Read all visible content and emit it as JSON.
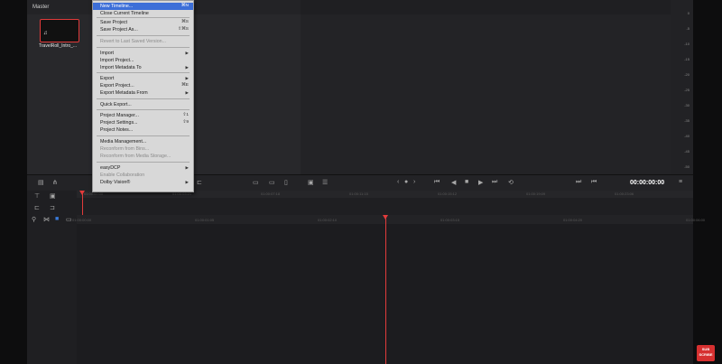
{
  "media_pool": {
    "header": "Master",
    "clip_name": "TravelRoll_Intro_...",
    "clip_glyph": "♫"
  },
  "file_menu": {
    "items": [
      {
        "label": "New Timeline...",
        "shortcut": "⌘N",
        "highlighted": true
      },
      {
        "label": "Close Current Timeline",
        "shortcut": ""
      },
      {
        "label": "Save Project",
        "shortcut": "⌘S"
      },
      {
        "label": "Save Project As...",
        "shortcut": "⇧⌘S"
      },
      {
        "label": "Revert to Last Saved Version...",
        "shortcut": "",
        "disabled": true
      },
      {
        "label": "Import",
        "arrow": "▶"
      },
      {
        "label": "Import Project...",
        "shortcut": ""
      },
      {
        "label": "Import Metadata To",
        "arrow": "▶"
      },
      {
        "label": "Export",
        "arrow": "▶"
      },
      {
        "label": "Export Project...",
        "shortcut": "⌘E"
      },
      {
        "label": "Export Metadata From",
        "arrow": "▶"
      },
      {
        "label": "Quick Export...",
        "shortcut": ""
      },
      {
        "label": "Project Manager...",
        "shortcut": "⇧1"
      },
      {
        "label": "Project Settings...",
        "shortcut": "⇧9"
      },
      {
        "label": "Project Notes...",
        "shortcut": ""
      },
      {
        "label": "Media Management...",
        "shortcut": ""
      },
      {
        "label": "Reconform from Bins...",
        "shortcut": "",
        "disabled": true
      },
      {
        "label": "Reconform from Media Storage...",
        "shortcut": "",
        "disabled": true
      },
      {
        "label": "easyDCP",
        "arrow": "▶"
      },
      {
        "label": "Enable Collaboration",
        "shortcut": "",
        "disabled": true
      },
      {
        "label": "Dolby Vision®",
        "arrow": "▶"
      }
    ]
  },
  "viewer": {
    "timecode": "00:00:00:00"
  },
  "meter": {
    "ticks": [
      "0",
      "-5",
      "-10",
      "-15",
      "-20",
      "-25",
      "-30",
      "-35",
      "-40",
      "-45",
      "-50"
    ]
  },
  "mini_ruler_labels": [
    "01:00:00:00",
    "01:00:03:21",
    "01:00:07:18",
    "01:00:11:15",
    "01:00:15:12",
    "01:00:19:09",
    "01:00:23:06"
  ],
  "main_ruler_labels": [
    "01:00:00:00",
    "01:00:01:05",
    "01:00:02:10",
    "01:00:03:15",
    "01:00:04:20",
    "01:00:06:00"
  ],
  "transport": {
    "prev": "⏮",
    "back": "◀",
    "stop": "■",
    "play": "▶",
    "next": "⏭",
    "loop": "⟲"
  },
  "branding": {
    "sub_top": "SUB",
    "sub_bottom": "SCRIBE"
  }
}
